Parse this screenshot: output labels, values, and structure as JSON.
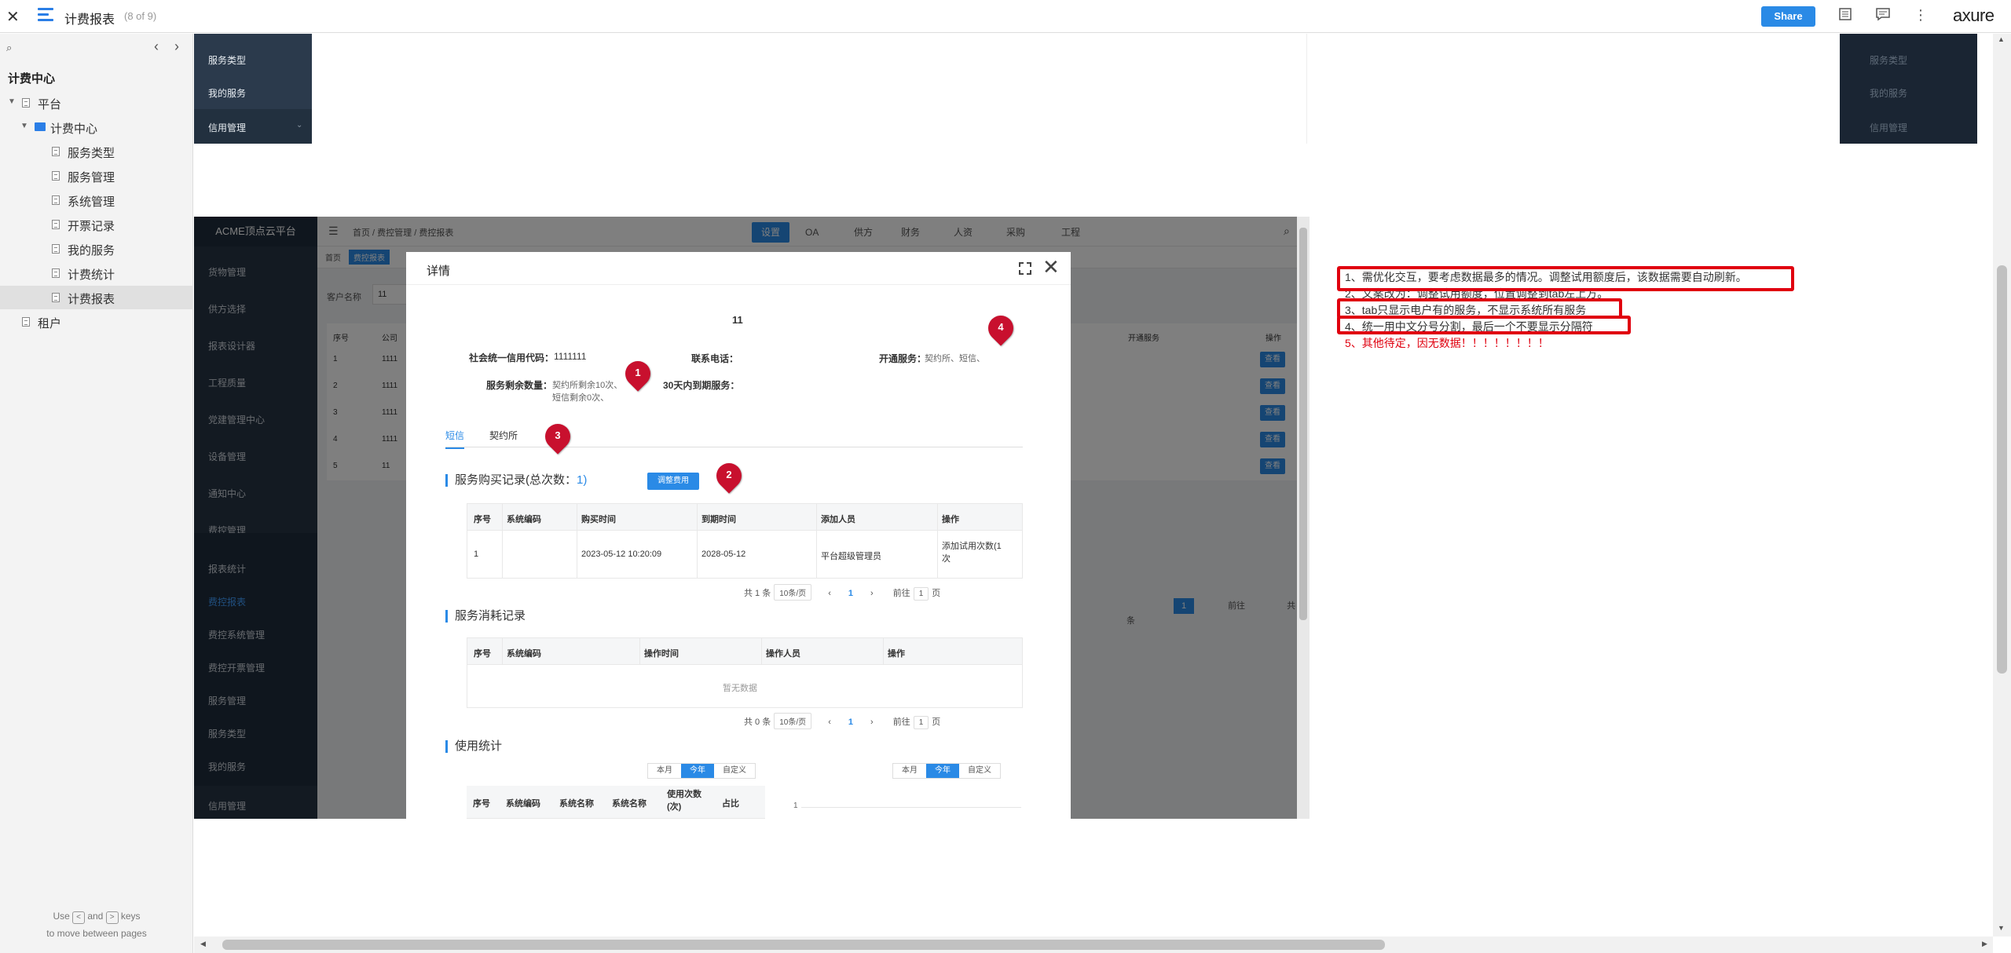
{
  "topbar": {
    "close": "✕",
    "title": "计费报表",
    "page_count": "(8 of 9)",
    "share": "Share",
    "logo": "axure",
    "icons": [
      "pages-icon",
      "comments-icon",
      "more-icon"
    ]
  },
  "sidebar": {
    "search_icon": "⌕",
    "prev": "‹",
    "next": "›",
    "root": "计费中心",
    "tree": [
      {
        "label": "平台",
        "level": 0,
        "type": "page",
        "arrow": true
      },
      {
        "label": "计费中心",
        "level": 1,
        "type": "folder",
        "arrow": true
      },
      {
        "label": "服务类型",
        "level": 2,
        "type": "page"
      },
      {
        "label": "服务管理",
        "level": 2,
        "type": "page"
      },
      {
        "label": "系统管理",
        "level": 2,
        "type": "page"
      },
      {
        "label": "开票记录",
        "level": 2,
        "type": "page"
      },
      {
        "label": "我的服务",
        "level": 2,
        "type": "page"
      },
      {
        "label": "计费统计",
        "level": 2,
        "type": "page"
      },
      {
        "label": "计费报表",
        "level": 2,
        "type": "page",
        "selected": true
      },
      {
        "label": "租户",
        "level": 0,
        "type": "page"
      }
    ],
    "hint_use": "Use",
    "hint_and": "and",
    "hint_keys": "keys",
    "hint_line2": "to move between pages",
    "key_prev": "<",
    "key_next": ">"
  },
  "top_preview": {
    "left_items": [
      "服务类型",
      "我的服务",
      "信用管理"
    ],
    "right_items": [
      "服务类型",
      "我的服务",
      "信用管理"
    ]
  },
  "app": {
    "brand": "ACME顶点云平台",
    "breadcrumb": [
      "首页",
      "费控管理",
      "费控报表"
    ],
    "header_tabs": [
      "设置",
      "OA",
      "供方",
      "财务",
      "人资",
      "采购",
      "工程"
    ],
    "tags": [
      "首页",
      "费控报表"
    ],
    "side_items": [
      "货物管理",
      "供方选择",
      "报表设计器",
      "工程质量",
      "党建管理中心",
      "设备管理",
      "通知中心",
      "费控管理"
    ],
    "side_sub": [
      "报表统计",
      "费控报表",
      "费控系统管理",
      "费控开票管理",
      "服务管理",
      "服务类型",
      "我的服务"
    ],
    "side_last": "信用管理",
    "filter_label": "客户名称",
    "filter_value": "11",
    "table_header": [
      "序号",
      "公司"
    ],
    "table_col_right": "开通服务",
    "table_col_op": "操作",
    "rows": [
      "1",
      "2",
      "3",
      "4",
      "5"
    ],
    "row_company": [
      "1111",
      "1111",
      "1111",
      "1111",
      "11"
    ],
    "view": "查看",
    "pager_total": "共 5 条",
    "pager_goto": "前往",
    "pager_page": "1"
  },
  "modal": {
    "title": "详情",
    "company": "11",
    "credit_code_label": "社会统一信用代码：",
    "credit_code": "1111111",
    "phone_label": "联系电话：",
    "open_service_label": "开通服务：",
    "open_service": "契约所、短信、",
    "remaining_label": "服务剩余数量：",
    "remaining_line1": "契约所剩余10次、",
    "remaining_line2": "短信剩余0次、",
    "expire_label": "30天内到期服务：",
    "tabs": [
      "短信",
      "契约所"
    ],
    "purchase_title": "服务购买记录(总次数：",
    "purchase_count": "1)",
    "adjust_button": "调整费用",
    "purchase_cols": [
      "序号",
      "系统编码",
      "购买时间",
      "到期时间",
      "添加人员",
      "操作"
    ],
    "purchase_row": [
      "1",
      "",
      "2023-05-12 10:20:09",
      "2028-05-12",
      "平台超级管理员",
      "添加试用次数(1次"
    ],
    "pager1": {
      "total": "共 1 条",
      "size": "10条/页",
      "page": "1",
      "goto": "前往",
      "goto_val": "1",
      "unit": "页"
    },
    "consume_title": "服务消耗记录",
    "consume_cols": [
      "序号",
      "系统编码",
      "操作时间",
      "操作人员",
      "操作"
    ],
    "empty": "暂无数据",
    "pager2": {
      "total": "共 0 条",
      "size": "10条/页",
      "page": "1",
      "goto": "前往",
      "goto_val": "1",
      "unit": "页"
    },
    "usage_title": "使用统计",
    "seg": [
      "本月",
      "今年",
      "自定义"
    ],
    "usage_cols": [
      "序号",
      "系统编码",
      "系统名称",
      "系统名称",
      "使用次数(次)",
      "占比"
    ],
    "chart_tick": "1"
  },
  "pins": [
    "1",
    "2",
    "3",
    "4"
  ],
  "notes": [
    "1、需优化交互，要考虑数据最多的情况。调整试用额度后，该数据需要自动刷新。",
    "2、文案改为：调整试用额度，位置调整到tab左上方。",
    "3、tab只显示电户有的服务，不显示系统所有服务",
    "4、统一用中文分号分割，最后一个不要显示分隔符",
    "5、其他待定，因无数据！！！！！！！！"
  ],
  "colors": {
    "accent": "#2a8ae6",
    "pin": "#c8102e",
    "note_box": "#e0000f",
    "dark_nav": "#263445"
  }
}
